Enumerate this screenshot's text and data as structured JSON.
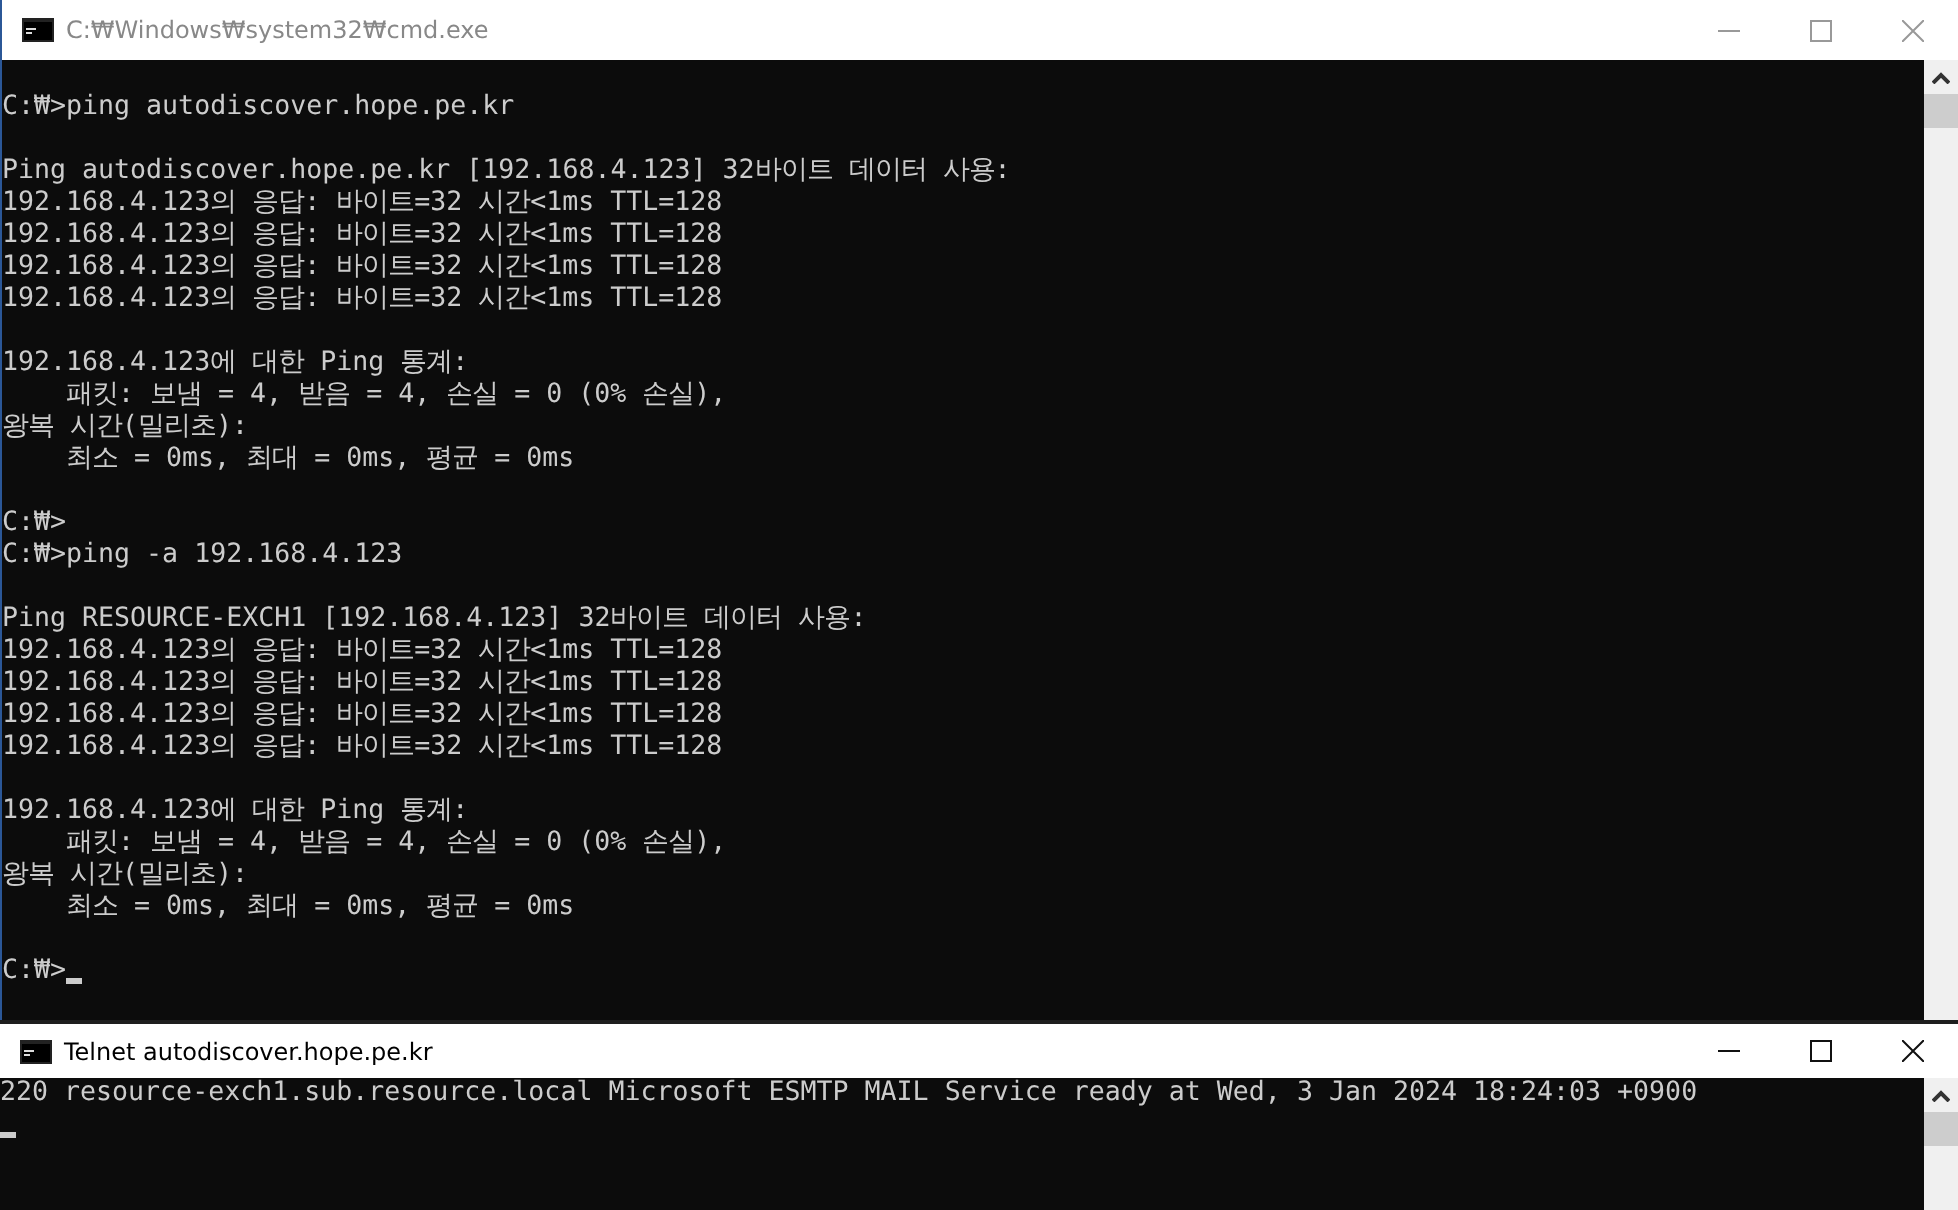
{
  "windows": [
    {
      "title": "C:₩Windows₩system32₩cmd.exe",
      "active": false,
      "blocks": [
        [
          {
            "text": "C:₩>ping autodiscover.hope.pe.kr",
            "cursor": false
          }
        ],
        [
          {
            "text": "Ping autodiscover.hope.pe.kr [192.168.4.123] 32바이트 데이터 사용:",
            "cursor": false
          },
          {
            "text": "192.168.4.123의 응답: 바이트=32 시간<1ms TTL=128",
            "cursor": false
          },
          {
            "text": "192.168.4.123의 응답: 바이트=32 시간<1ms TTL=128",
            "cursor": false
          },
          {
            "text": "192.168.4.123의 응답: 바이트=32 시간<1ms TTL=128",
            "cursor": false
          },
          {
            "text": "192.168.4.123의 응답: 바이트=32 시간<1ms TTL=128",
            "cursor": false
          }
        ],
        [
          {
            "text": "192.168.4.123에 대한 Ping 통계:",
            "cursor": false
          },
          {
            "text": "    패킷: 보냄 = 4, 받음 = 4, 손실 = 0 (0% 손실),",
            "cursor": false
          },
          {
            "text": "왕복 시간(밀리초):",
            "cursor": false
          },
          {
            "text": "    최소 = 0ms, 최대 = 0ms, 평균 = 0ms",
            "cursor": false
          }
        ],
        [
          {
            "text": "C:₩>",
            "cursor": false
          },
          {
            "text": "C:₩>ping -a 192.168.4.123",
            "cursor": false
          }
        ],
        [
          {
            "text": "Ping RESOURCE-EXCH1 [192.168.4.123] 32바이트 데이터 사용:",
            "cursor": false
          },
          {
            "text": "192.168.4.123의 응답: 바이트=32 시간<1ms TTL=128",
            "cursor": false
          },
          {
            "text": "192.168.4.123의 응답: 바이트=32 시간<1ms TTL=128",
            "cursor": false
          },
          {
            "text": "192.168.4.123의 응답: 바이트=32 시간<1ms TTL=128",
            "cursor": false
          },
          {
            "text": "192.168.4.123의 응답: 바이트=32 시간<1ms TTL=128",
            "cursor": false
          }
        ],
        [
          {
            "text": "192.168.4.123에 대한 Ping 통계:",
            "cursor": false
          },
          {
            "text": "    패킷: 보냄 = 4, 받음 = 4, 손실 = 0 (0% 손실),",
            "cursor": false
          },
          {
            "text": "왕복 시간(밀리초):",
            "cursor": false
          },
          {
            "text": "    최소 = 0ms, 최대 = 0ms, 평균 = 0ms",
            "cursor": false
          }
        ],
        [
          {
            "text": "C:₩>",
            "cursor": true
          }
        ]
      ]
    },
    {
      "title": "Telnet autodiscover.hope.pe.kr",
      "active": true,
      "blocks": [
        [
          {
            "text": "220 resource-exch1.sub.resource.local Microsoft ESMTP MAIL Service ready at Wed, 3 Jan 2024 18:24:03 +0900",
            "cursor": false
          },
          {
            "cursor": true
          }
        ]
      ]
    }
  ]
}
